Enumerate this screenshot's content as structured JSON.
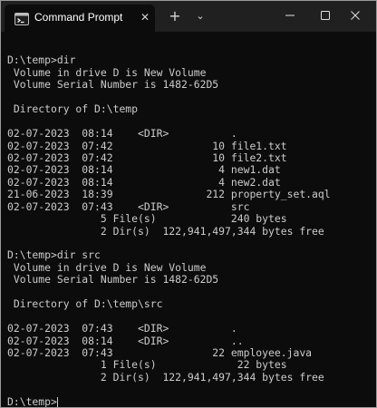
{
  "window": {
    "title": "Command Prompt",
    "tab_close_glyph": "✕",
    "new_tab_glyph": "+",
    "dropdown_glyph": "⌄"
  },
  "terminal": {
    "lines": [
      "",
      "D:\\temp>dir",
      " Volume in drive D is New Volume",
      " Volume Serial Number is 1482-62D5",
      "",
      " Directory of D:\\temp",
      "",
      "02-07-2023  08:14    <DIR>          .",
      "02-07-2023  07:42                10 file1.txt",
      "02-07-2023  07:42                10 file2.txt",
      "02-07-2023  08:14                 4 new1.dat",
      "02-07-2023  08:14                 4 new2.dat",
      "21-06-2023  18:39               212 property_set.aql",
      "02-07-2023  07:43    <DIR>          src",
      "               5 File(s)            240 bytes",
      "               2 Dir(s)  122,941,497,344 bytes free",
      "",
      "D:\\temp>dir src",
      " Volume in drive D is New Volume",
      " Volume Serial Number is 1482-62D5",
      "",
      " Directory of D:\\temp\\src",
      "",
      "02-07-2023  07:43    <DIR>          .",
      "02-07-2023  08:14    <DIR>          ..",
      "02-07-2023  07:43                22 employee.java",
      "               1 File(s)             22 bytes",
      "               2 Dir(s)  122,941,497,344 bytes free",
      ""
    ],
    "prompt": "D:\\temp>"
  }
}
